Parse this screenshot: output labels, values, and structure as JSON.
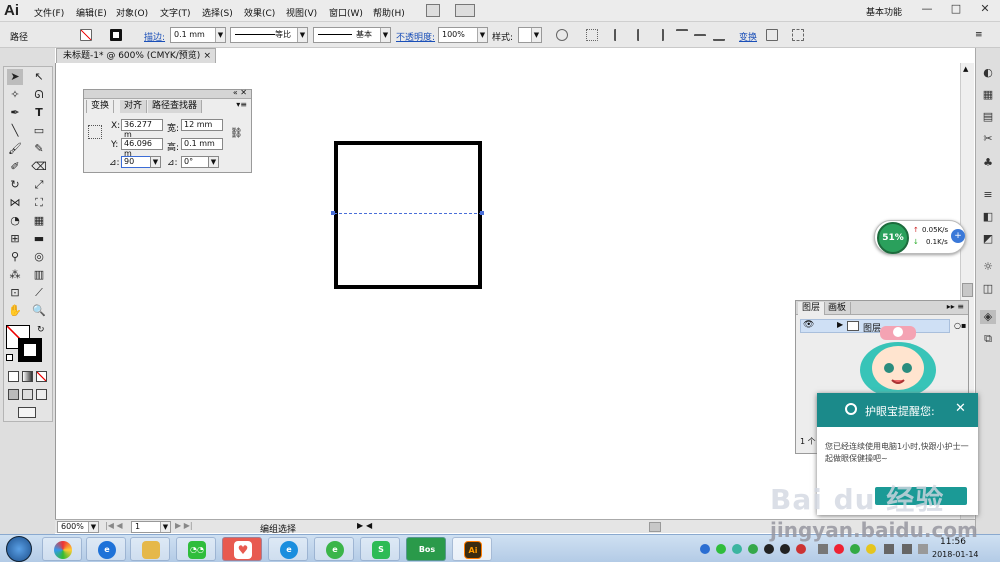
{
  "menubar": {
    "app_logo": "Ai",
    "items": [
      "文件(F)",
      "编辑(E)",
      "对象(O)",
      "文字(T)",
      "选择(S)",
      "效果(C)",
      "视图(V)",
      "窗口(W)",
      "帮助(H)"
    ],
    "workspace": "基本功能",
    "window_controls": [
      "—",
      "□",
      "✕"
    ]
  },
  "control_bar": {
    "selection_label": "路径",
    "stroke_label": "描边:",
    "stroke_value": "0.1 mm",
    "profile_label": "等比",
    "brush_label": "基本",
    "opacity_label": "不透明度:",
    "opacity_value": "100%",
    "style_label": "样式:",
    "transform_link": "变换"
  },
  "document": {
    "tab_title": "未标题-1* @ 600% (CMYK/预览)",
    "close": "×"
  },
  "transform_panel": {
    "tabs": [
      "变换",
      "对齐",
      "路径查找器"
    ],
    "x_label": "X:",
    "x_value": "36.277 m",
    "w_label": "宽:",
    "w_value": "12 mm",
    "y_label": "Y:",
    "y_value": "46.096 m",
    "h_label": "高:",
    "h_value": "0.1 mm",
    "rotate_label": "⊿:",
    "rotate_value": "90",
    "shear_label": "⊿:",
    "shear_value": "0°"
  },
  "net_monitor": {
    "percent": "51%",
    "upload": "0.05K/s",
    "download": "0.1K/s"
  },
  "layers_panel": {
    "tabs": [
      "图层",
      "画板"
    ],
    "layer_name": "图层",
    "footer": "1 个"
  },
  "notification": {
    "title": "护眼宝提醒您:",
    "message": "您已经连续使用电脑1小时,快跟小护士一起做眼保健操吧~",
    "close": "✕"
  },
  "status_bar": {
    "zoom": "600%",
    "page": "1",
    "status_text": "编组选择"
  },
  "taskbar": {
    "apps": [
      "start",
      "explorer-balls",
      "ie",
      "folder",
      "wechat",
      "heart",
      "ie2",
      "360",
      "wps",
      "bos",
      "ai"
    ],
    "bos_label": "Bos",
    "ai_label": "Ai",
    "clock_time": "11:56",
    "clock_date": "2018-01-14"
  },
  "watermark": {
    "brand": "Bai du 经验",
    "url": "jingyan.baidu.com"
  },
  "colors": {
    "ai_orange": "#ff7b00",
    "accent_teal": "#1b8a8a",
    "guide_blue": "#4a6fd8"
  }
}
